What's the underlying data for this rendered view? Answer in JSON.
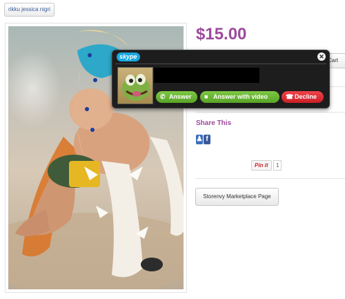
{
  "tag_button": {
    "label": "rikku jessica nigri"
  },
  "product": {
    "price": "$15.00",
    "cart_label": "Cart"
  },
  "share": {
    "title": "Share This",
    "pinit_label": "Pin it",
    "pin_count": "1"
  },
  "storenvy": {
    "label": "Storenvy Marketplace Page"
  },
  "skype": {
    "logo": "skype",
    "close_symbol": "✕",
    "buttons": {
      "answer": "Answer",
      "answer_video": "Answer with video",
      "decline": "Decline"
    }
  },
  "colors": {
    "accent": "#9c4a9c",
    "answer_green": "#59a327",
    "decline_red": "#cc1f26",
    "skype_blue": "#19a8e0"
  }
}
